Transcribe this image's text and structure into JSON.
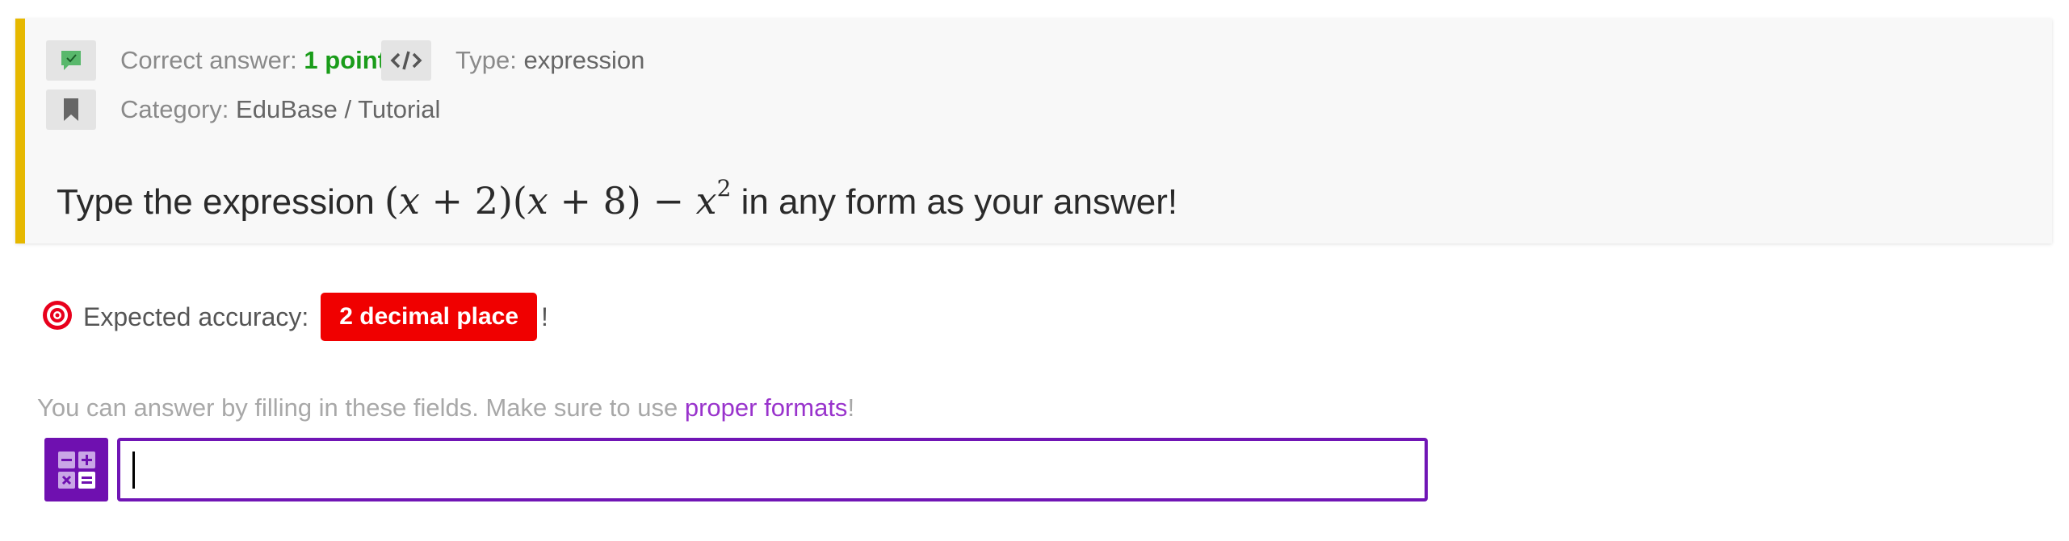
{
  "question": {
    "correct_answer_label": "Correct answer:",
    "correct_answer_value": "1 point",
    "type_label": "Type:",
    "type_value": "expression",
    "category_label": "Category:",
    "category_value": "EduBase / Tutorial",
    "text_before": "Type the expression ",
    "math": {
      "p1_open": "(",
      "x1": "x",
      "op1": " + 2)(",
      "x2": "x",
      "op2": " + 8) − ",
      "x3": "x",
      "exp": "2"
    },
    "text_after": " in any form as your answer!"
  },
  "accuracy": {
    "label": "Expected accuracy:",
    "badge": "2 decimal place",
    "suffix": "!"
  },
  "hint": {
    "text": "You can answer by filling in these fields. Make sure to use ",
    "link": "proper formats",
    "suffix": "!"
  },
  "answer": {
    "value": "",
    "placeholder": ""
  },
  "icons": {
    "correct": "comment-check-icon",
    "type": "code-icon",
    "category": "bookmark-icon",
    "accuracy": "target-icon",
    "calculator": "calculator-icon"
  },
  "colors": {
    "accent_bar": "#e6b800",
    "points_green": "#1a9c1a",
    "badge_red": "#f00000",
    "input_purple": "#7015b5",
    "link_purple": "#9933cc"
  }
}
